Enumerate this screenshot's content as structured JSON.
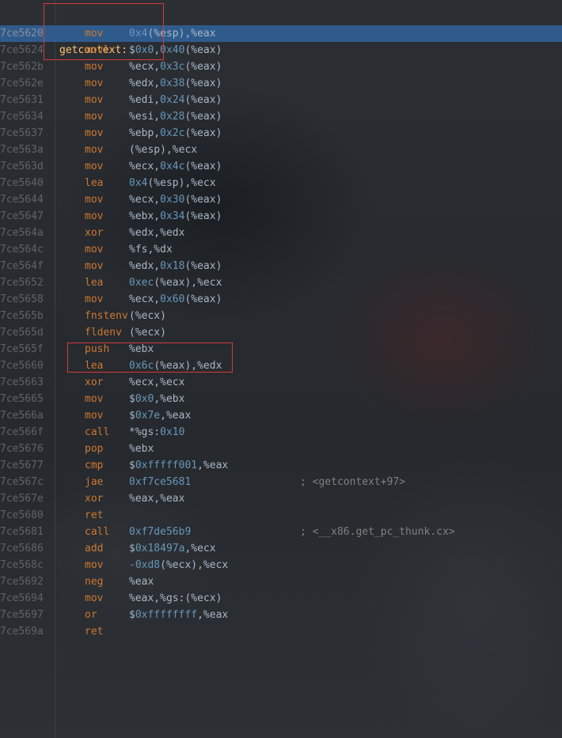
{
  "function_label": {
    "address": "7ce5620",
    "label": "getcontext:"
  },
  "lines": [
    {
      "address": "7ce5620",
      "mnemonic": "mov",
      "operands": "0x4(%esp),%eax",
      "comment": "",
      "selected": true
    },
    {
      "address": "7ce5624",
      "mnemonic": "movl",
      "operands": "$0x0,0x40(%eax)",
      "comment": ""
    },
    {
      "address": "7ce562b",
      "mnemonic": "mov",
      "operands": "%ecx,0x3c(%eax)",
      "comment": ""
    },
    {
      "address": "7ce562e",
      "mnemonic": "mov",
      "operands": "%edx,0x38(%eax)",
      "comment": ""
    },
    {
      "address": "7ce5631",
      "mnemonic": "mov",
      "operands": "%edi,0x24(%eax)",
      "comment": ""
    },
    {
      "address": "7ce5634",
      "mnemonic": "mov",
      "operands": "%esi,0x28(%eax)",
      "comment": ""
    },
    {
      "address": "7ce5637",
      "mnemonic": "mov",
      "operands": "%ebp,0x2c(%eax)",
      "comment": ""
    },
    {
      "address": "7ce563a",
      "mnemonic": "mov",
      "operands": "(%esp),%ecx",
      "comment": ""
    },
    {
      "address": "7ce563d",
      "mnemonic": "mov",
      "operands": "%ecx,0x4c(%eax)",
      "comment": ""
    },
    {
      "address": "7ce5640",
      "mnemonic": "lea",
      "operands": "0x4(%esp),%ecx",
      "comment": ""
    },
    {
      "address": "7ce5644",
      "mnemonic": "mov",
      "operands": "%ecx,0x30(%eax)",
      "comment": ""
    },
    {
      "address": "7ce5647",
      "mnemonic": "mov",
      "operands": "%ebx,0x34(%eax)",
      "comment": ""
    },
    {
      "address": "7ce564a",
      "mnemonic": "xor",
      "operands": "%edx,%edx",
      "comment": ""
    },
    {
      "address": "7ce564c",
      "mnemonic": "mov",
      "operands": "%fs,%dx",
      "comment": ""
    },
    {
      "address": "7ce564f",
      "mnemonic": "mov",
      "operands": "%edx,0x18(%eax)",
      "comment": ""
    },
    {
      "address": "7ce5652",
      "mnemonic": "lea",
      "operands": "0xec(%eax),%ecx",
      "comment": ""
    },
    {
      "address": "7ce5658",
      "mnemonic": "mov",
      "operands": "%ecx,0x60(%eax)",
      "comment": ""
    },
    {
      "address": "7ce565b",
      "mnemonic": "fnstenv",
      "operands": "(%ecx)",
      "comment": ""
    },
    {
      "address": "7ce565d",
      "mnemonic": "fldenv",
      "operands": "(%ecx)",
      "comment": ""
    },
    {
      "address": "7ce565f",
      "mnemonic": "push",
      "operands": "%ebx",
      "comment": ""
    },
    {
      "address": "7ce5660",
      "mnemonic": "lea",
      "operands": "0x6c(%eax),%edx",
      "comment": ""
    },
    {
      "address": "7ce5663",
      "mnemonic": "xor",
      "operands": "%ecx,%ecx",
      "comment": ""
    },
    {
      "address": "7ce5665",
      "mnemonic": "mov",
      "operands": "$0x0,%ebx",
      "comment": ""
    },
    {
      "address": "7ce566a",
      "mnemonic": "mov",
      "operands": "$0x7e,%eax",
      "comment": ""
    },
    {
      "address": "7ce566f",
      "mnemonic": "call",
      "operands": "*%gs:0x10",
      "comment": ""
    },
    {
      "address": "7ce5676",
      "mnemonic": "pop",
      "operands": "%ebx",
      "comment": ""
    },
    {
      "address": "7ce5677",
      "mnemonic": "cmp",
      "operands": "$0xfffff001,%eax",
      "comment": ""
    },
    {
      "address": "7ce567c",
      "mnemonic": "jae",
      "operands": "0xf7ce5681",
      "comment": "; <getcontext+97>"
    },
    {
      "address": "7ce567e",
      "mnemonic": "xor",
      "operands": "%eax,%eax",
      "comment": ""
    },
    {
      "address": "7ce5680",
      "mnemonic": "ret",
      "operands": "",
      "comment": ""
    },
    {
      "address": "7ce5681",
      "mnemonic": "call",
      "operands": "0xf7de56b9",
      "comment": "; <__x86.get_pc_thunk.cx>"
    },
    {
      "address": "7ce5686",
      "mnemonic": "add",
      "operands": "$0x18497a,%ecx",
      "comment": ""
    },
    {
      "address": "7ce568c",
      "mnemonic": "mov",
      "operands": "-0xd8(%ecx),%ecx",
      "comment": ""
    },
    {
      "address": "7ce5692",
      "mnemonic": "neg",
      "operands": "%eax",
      "comment": ""
    },
    {
      "address": "7ce5694",
      "mnemonic": "mov",
      "operands": "%eax,%gs:(%ecx)",
      "comment": ""
    },
    {
      "address": "7ce5697",
      "mnemonic": "or",
      "operands": "$0xffffffff,%eax",
      "comment": ""
    },
    {
      "address": "7ce569a",
      "mnemonic": "ret",
      "operands": "",
      "comment": ""
    }
  ],
  "colors": {
    "background": "#2a2d31",
    "selection": "#2f5b8c",
    "label": "#ffc66d",
    "mnemonic": "#cc7832",
    "operand": "#a9b7c6",
    "number": "#6897bb",
    "comment": "#808080",
    "address": "#606366",
    "annotation_box": "#d83a3a"
  }
}
